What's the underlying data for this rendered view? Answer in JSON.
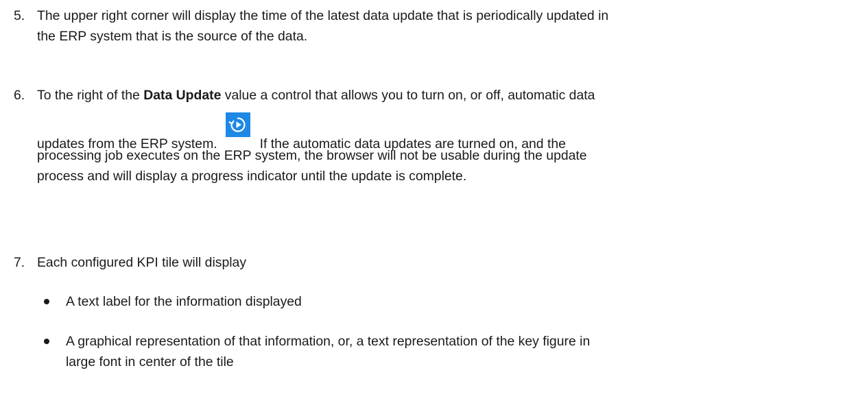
{
  "items": [
    {
      "number": "5.",
      "lines": [
        "The upper right corner will display the time of the latest data update that is periodically updated in",
        "the ERP system that is the source of the data."
      ]
    },
    {
      "number": "6.",
      "line1_pre": "To the right of the ",
      "line1_bold": "Data Update",
      "line1_post": " value a control that allows you to turn on, or off, automatic data",
      "line2_pre": "updates from the ERP system.",
      "line2_post": "If the automatic data updates are turned on, and the",
      "line3": "processing job executes on the ERP system, the browser will not be usable during the update",
      "line4": "process and will display a progress indicator until the update is complete.",
      "control_icon": "auto-update-toggle-icon",
      "control_color": "#1e88e5"
    },
    {
      "number": "7.",
      "lines": [
        "Each configured KPI tile will display"
      ],
      "bullets": [
        {
          "lines": [
            "A text label for the information displayed"
          ]
        },
        {
          "lines": [
            "A graphical representation of that information, or, a text representation of the key figure in",
            "large font in center of the tile"
          ]
        }
      ]
    }
  ]
}
